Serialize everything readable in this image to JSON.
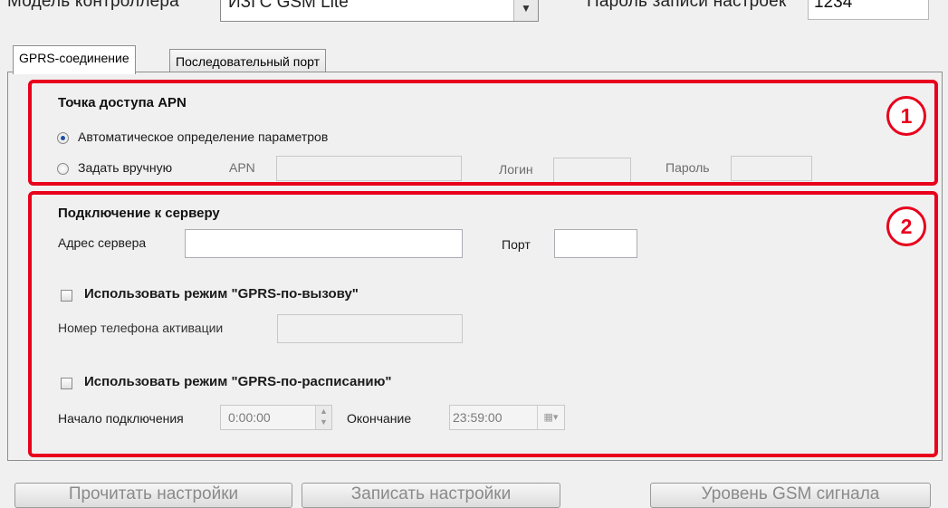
{
  "top": {
    "controller_label": "Модель контроллера",
    "controller_value": "ИЗГС GSM Lite",
    "settings_password_label": "Пароль записи настроек",
    "settings_password_value": "1234"
  },
  "tabs": [
    {
      "label": "GPRS-соединение",
      "active": true
    },
    {
      "label": "Последовательный порт",
      "active": false
    }
  ],
  "apn_group": {
    "title": "Точка доступа APN",
    "auto_option": "Автоматическое определение параметров",
    "auto_selected": true,
    "manual_option": "Задать вручную",
    "apn_label": "APN",
    "apn_value": "",
    "login_label": "Логин",
    "login_value": "",
    "password_label": "Пароль",
    "password_value": ""
  },
  "server_group": {
    "title": "Подключение к серверу",
    "address_label": "Адрес сервера",
    "address_value": "",
    "port_label": "Порт",
    "port_value": "",
    "gprs_call_checkbox": "Использовать режим \"GPRS-по-вызову\"",
    "gprs_call_checked": false,
    "activation_phone_label": "Номер телефона активации",
    "activation_phone_value": "",
    "gprs_schedule_checkbox": "Использовать режим \"GPRS-по-расписанию\"",
    "gprs_schedule_checked": false,
    "start_label": "Начало подключения",
    "start_value": "0:00:00",
    "end_label": "Окончание",
    "end_value": "23:59:00"
  },
  "annotations": {
    "marker_1": "1",
    "marker_2": "2",
    "color": "#e8001c"
  },
  "bottom_buttons": [
    {
      "label": "Прочитать настройки"
    },
    {
      "label": "Записать настройки"
    },
    {
      "label": "Уровень GSM сигнала"
    }
  ],
  "icons": {
    "dropdown": "chevron-down-icon",
    "spin": "spin-updown-icon",
    "calendar": "calendar-icon"
  }
}
